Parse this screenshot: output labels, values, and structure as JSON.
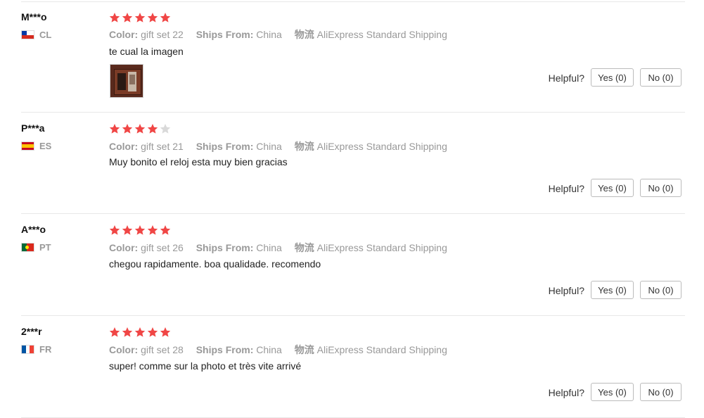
{
  "colors": {
    "star_filled": "#f04645",
    "star_empty": "#d9d9d9",
    "divider": "#e8e8e8"
  },
  "labels": {
    "color_label": "Color:",
    "ships_label": "Ships From:",
    "logistics_label": "物流",
    "helpful": "Helpful?"
  },
  "reviews": [
    {
      "user": "M***o",
      "country_code": "CL",
      "rating": 5,
      "color": "gift set 22",
      "ships_from": "China",
      "logistics": "AliExpress Standard Shipping",
      "text": "te cual la imagen",
      "has_photo": true,
      "yes": "Yes (0)",
      "no": "No (0)"
    },
    {
      "user": "P***a",
      "country_code": "ES",
      "rating": 4,
      "color": "gift set 21",
      "ships_from": "China",
      "logistics": "AliExpress Standard Shipping",
      "text": "Muy bonito el reloj esta muy bien gracias",
      "has_photo": false,
      "yes": "Yes (0)",
      "no": "No (0)"
    },
    {
      "user": "A***o",
      "country_code": "PT",
      "rating": 5,
      "color": "gift set 26",
      "ships_from": "China",
      "logistics": "AliExpress Standard Shipping",
      "text": "chegou rapidamente. boa qualidade. recomendo",
      "has_photo": false,
      "yes": "Yes (0)",
      "no": "No (0)"
    },
    {
      "user": "2***r",
      "country_code": "FR",
      "rating": 5,
      "color": "gift set 28",
      "ships_from": "China",
      "logistics": "AliExpress Standard Shipping",
      "text": "super! comme sur la photo et très vite arrivé",
      "has_photo": false,
      "yes": "Yes (0)",
      "no": "No (0)"
    }
  ]
}
